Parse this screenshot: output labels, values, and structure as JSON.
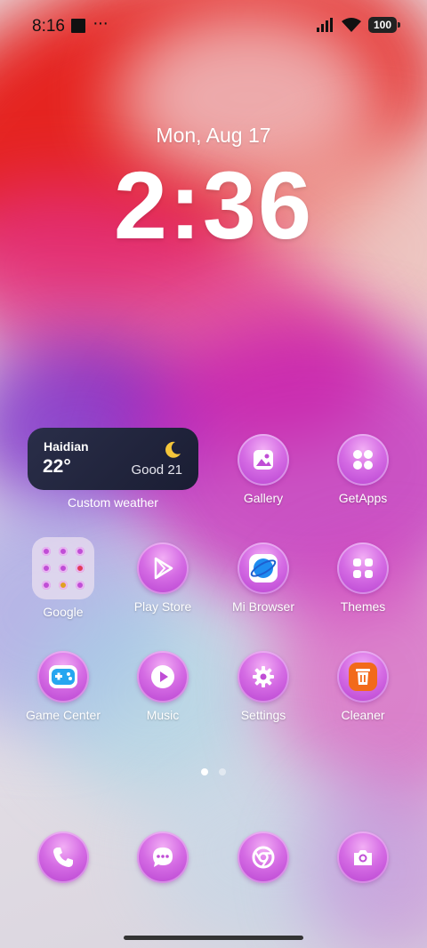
{
  "status_bar": {
    "time": "8:16",
    "more": "···",
    "battery": "100"
  },
  "lockscreen": {
    "date": "Mon, Aug 17",
    "time": "2:36"
  },
  "weather_widget": {
    "city": "Haidian",
    "temperature": "22°",
    "air_quality": "Good 21",
    "label": "Custom weather",
    "icon": "moon-icon"
  },
  "apps_row1": [
    {
      "label": "Gallery",
      "icon": "gallery-icon"
    },
    {
      "label": "GetApps",
      "icon": "grid-icon"
    }
  ],
  "apps_row2": [
    {
      "label": "Google",
      "icon": "folder"
    },
    {
      "label": "Play Store",
      "icon": "play-store-icon"
    },
    {
      "label": "Mi Browser",
      "icon": "browser-icon"
    },
    {
      "label": "Themes",
      "icon": "grid-icon"
    }
  ],
  "apps_row3": [
    {
      "label": "Game Center",
      "icon": "gamepad-icon"
    },
    {
      "label": "Music",
      "icon": "music-icon"
    },
    {
      "label": "Settings",
      "icon": "gear-icon"
    },
    {
      "label": "Cleaner",
      "icon": "trash-icon"
    }
  ],
  "pager": {
    "pages": 2,
    "current": 1
  },
  "dock": [
    {
      "icon": "phone-icon"
    },
    {
      "icon": "messages-icon"
    },
    {
      "icon": "chrome-icon"
    },
    {
      "icon": "camera-icon"
    }
  ],
  "colors": {
    "icon_purple": "#c04ed6",
    "widget_bg": "#23263f",
    "accent_red": "#e8201e"
  }
}
